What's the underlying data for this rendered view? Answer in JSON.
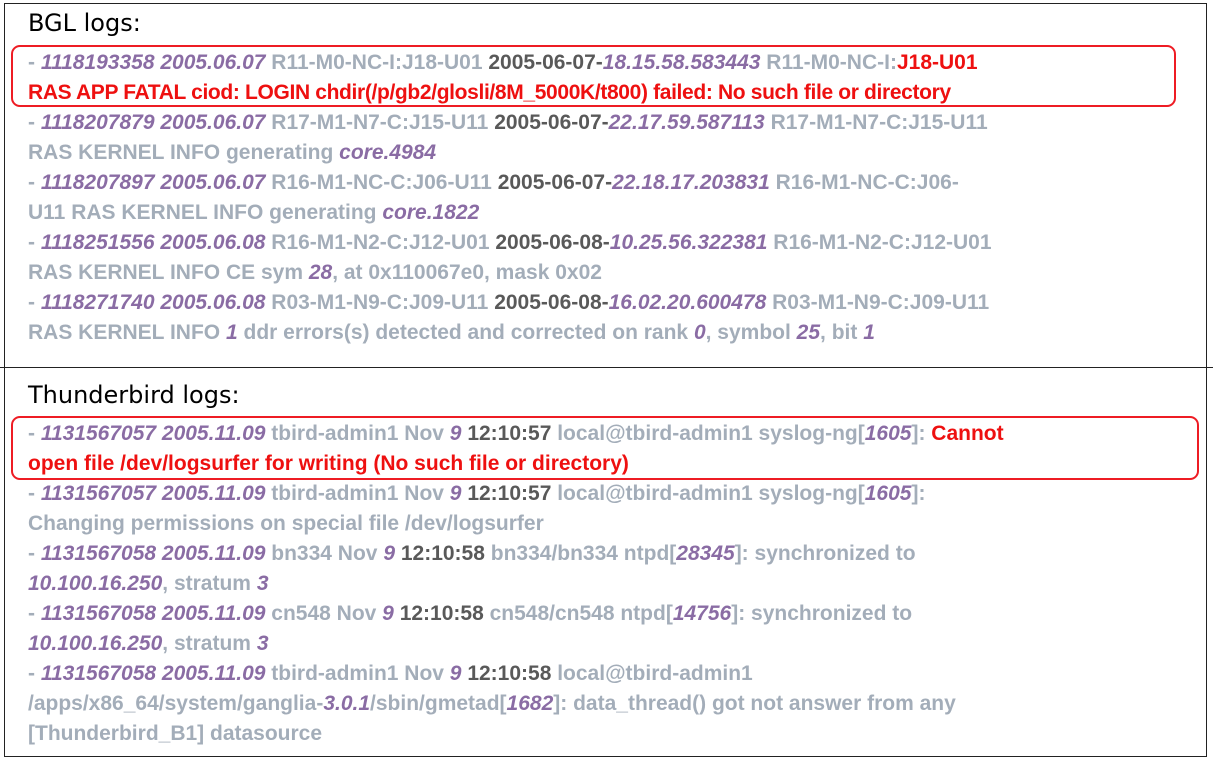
{
  "bgl": {
    "heading": "BGL logs:",
    "lines": [
      [
        [
          {
            "c": "dim",
            "t": "- "
          },
          {
            "c": "p",
            "t": "1118193358 2005.06.07 "
          },
          {
            "c": "dim",
            "t": "R11-M0-NC-I:J18-U01 "
          },
          {
            "c": "d",
            "t": "2005-06-07-"
          },
          {
            "c": "p",
            "t": "18.15.58.583443 "
          },
          {
            "c": "dim",
            "t": "R11-M0-NC-I:"
          },
          {
            "c": "r",
            "t": "J18-U01"
          }
        ],
        [
          {
            "c": "r",
            "t": "RAS APP FATAL ciod: LOGIN chdir(/p/gb2/glosli/8M_5000K/t800) failed: No such file or directory"
          }
        ]
      ],
      [
        [
          {
            "c": "dim",
            "t": "- "
          },
          {
            "c": "p",
            "t": "1118207879 2005.06.07 "
          },
          {
            "c": "dim",
            "t": "R17-M1-N7-C:J15-U11 "
          },
          {
            "c": "d",
            "t": "2005-06-07-"
          },
          {
            "c": "p",
            "t": "22.17.59.587113 "
          },
          {
            "c": "dim",
            "t": "R17-M1-N7-C:J15-U11"
          }
        ],
        [
          {
            "c": "dim",
            "t": "RAS KERNEL INFO generating "
          },
          {
            "c": "p",
            "t": "core.4984"
          }
        ]
      ],
      [
        [
          {
            "c": "dim",
            "t": "- "
          },
          {
            "c": "p",
            "t": "1118207897 2005.06.07 "
          },
          {
            "c": "dim",
            "t": "R16-M1-NC-C:J06-U11 "
          },
          {
            "c": "d",
            "t": "2005-06-07-"
          },
          {
            "c": "p",
            "t": "22.18.17.203831 "
          },
          {
            "c": "dim",
            "t": "R16-M1-NC-C:J06-"
          }
        ],
        [
          {
            "c": "dim",
            "t": "U11 RAS KERNEL INFO generating "
          },
          {
            "c": "p",
            "t": "core.1822"
          }
        ]
      ],
      [
        [
          {
            "c": "dim",
            "t": "- "
          },
          {
            "c": "p",
            "t": "1118251556 2005.06.08 "
          },
          {
            "c": "dim",
            "t": "R16-M1-N2-C:J12-U01 "
          },
          {
            "c": "d",
            "t": "2005-06-08-"
          },
          {
            "c": "p",
            "t": "10.25.56.322381 "
          },
          {
            "c": "dim",
            "t": "R16-M1-N2-C:J12-U01"
          }
        ],
        [
          {
            "c": "dim",
            "t": "RAS KERNEL INFO CE sym "
          },
          {
            "c": "p",
            "t": "28"
          },
          {
            "c": "dim",
            "t": ", at 0x110067e0, mask 0x02"
          }
        ]
      ],
      [
        [
          {
            "c": "dim",
            "t": "- "
          },
          {
            "c": "p",
            "t": "1118271740 2005.06.08 "
          },
          {
            "c": "dim",
            "t": "R03-M1-N9-C:J09-U11 "
          },
          {
            "c": "d",
            "t": "2005-06-08-"
          },
          {
            "c": "p",
            "t": "16.02.20.600478 "
          },
          {
            "c": "dim",
            "t": "R03-M1-N9-C:J09-U11"
          }
        ],
        [
          {
            "c": "dim",
            "t": "RAS KERNEL INFO "
          },
          {
            "c": "p",
            "t": "1"
          },
          {
            "c": "dim",
            "t": " ddr errors(s) detected and corrected on rank "
          },
          {
            "c": "p",
            "t": "0"
          },
          {
            "c": "dim",
            "t": ", symbol "
          },
          {
            "c": "p",
            "t": "25"
          },
          {
            "c": "dim",
            "t": ", bit "
          },
          {
            "c": "p",
            "t": "1"
          }
        ]
      ]
    ]
  },
  "thunderbird": {
    "heading": "Thunderbird logs:",
    "lines": [
      [
        [
          {
            "c": "dim",
            "t": "- "
          },
          {
            "c": "p",
            "t": "1131567057 2005.11.09 "
          },
          {
            "c": "dim",
            "t": "tbird-admin1  Nov "
          },
          {
            "c": "p",
            "t": "9 "
          },
          {
            "c": "d",
            "t": "12:10:57 "
          },
          {
            "c": "dim",
            "t": "local@tbird-admin1  syslog-ng["
          },
          {
            "c": "p",
            "t": "1605"
          },
          {
            "c": "dim",
            "t": "]: "
          },
          {
            "c": "r",
            "t": "Cannot"
          }
        ],
        [
          {
            "c": "r",
            "t": "open file /dev/logsurfer for writing (No such file or directory)"
          }
        ]
      ],
      [
        [
          {
            "c": "dim",
            "t": "- "
          },
          {
            "c": "p",
            "t": "1131567057 2005.11.09 "
          },
          {
            "c": "dim",
            "t": "tbird-admin1  Nov "
          },
          {
            "c": "p",
            "t": "9 "
          },
          {
            "c": "d",
            "t": "12:10:57 "
          },
          {
            "c": "dim",
            "t": "local@tbird-admin1  syslog-ng["
          },
          {
            "c": "p",
            "t": "1605"
          },
          {
            "c": "dim",
            "t": "]:"
          }
        ],
        [
          {
            "c": "dim",
            "t": "Changing permissions on special file /dev/logsurfer"
          }
        ]
      ],
      [
        [
          {
            "c": "dim",
            "t": "- "
          },
          {
            "c": "p",
            "t": "1131567058 2005.11.09 "
          },
          {
            "c": "dim",
            "t": "bn334 Nov "
          },
          {
            "c": "p",
            "t": "9 "
          },
          {
            "c": "d",
            "t": "12:10:58 "
          },
          {
            "c": "dim",
            "t": "bn334/bn334 ntpd["
          },
          {
            "c": "p",
            "t": "28345"
          },
          {
            "c": "dim",
            "t": "]: synchronized to"
          }
        ],
        [
          {
            "c": "p",
            "t": "10.100.16.250"
          },
          {
            "c": "dim",
            "t": ", stratum "
          },
          {
            "c": "p",
            "t": "3"
          }
        ]
      ],
      [
        [
          {
            "c": "dim",
            "t": "- "
          },
          {
            "c": "p",
            "t": "1131567058 2005.11.09 "
          },
          {
            "c": "dim",
            "t": "cn548 Nov "
          },
          {
            "c": "p",
            "t": "9 "
          },
          {
            "c": "d",
            "t": "12:10:58 "
          },
          {
            "c": "dim",
            "t": "cn548/cn548 ntpd["
          },
          {
            "c": "p",
            "t": "14756"
          },
          {
            "c": "dim",
            "t": "]: synchronized to"
          }
        ],
        [
          {
            "c": "p",
            "t": "10.100.16.250"
          },
          {
            "c": "dim",
            "t": ", stratum "
          },
          {
            "c": "p",
            "t": "3"
          }
        ]
      ],
      [
        [
          {
            "c": "dim",
            "t": "- "
          },
          {
            "c": "p",
            "t": "1131567058 2005.11.09 "
          },
          {
            "c": "dim",
            "t": "tbird-admin1  Nov "
          },
          {
            "c": "p",
            "t": "9 "
          },
          {
            "c": "d",
            "t": "12:10:58 "
          },
          {
            "c": "dim",
            "t": "local@tbird-admin1"
          }
        ],
        [
          {
            "c": "dim",
            "t": "/apps/x86_64/system/ganglia-"
          },
          {
            "c": "p",
            "t": "3.0.1"
          },
          {
            "c": "dim",
            "t": "/sbin/gmetad["
          },
          {
            "c": "p",
            "t": "1682"
          },
          {
            "c": "dim",
            "t": "]:  data_thread() got not answer from any"
          }
        ],
        [
          {
            "c": "dim",
            "t": "[Thunderbird_B1] datasource"
          }
        ]
      ]
    ]
  },
  "colors": {
    "dim": "#a3adb9",
    "purple": "#8a6ca4",
    "dark": "#595959",
    "red": "#ee1010"
  }
}
